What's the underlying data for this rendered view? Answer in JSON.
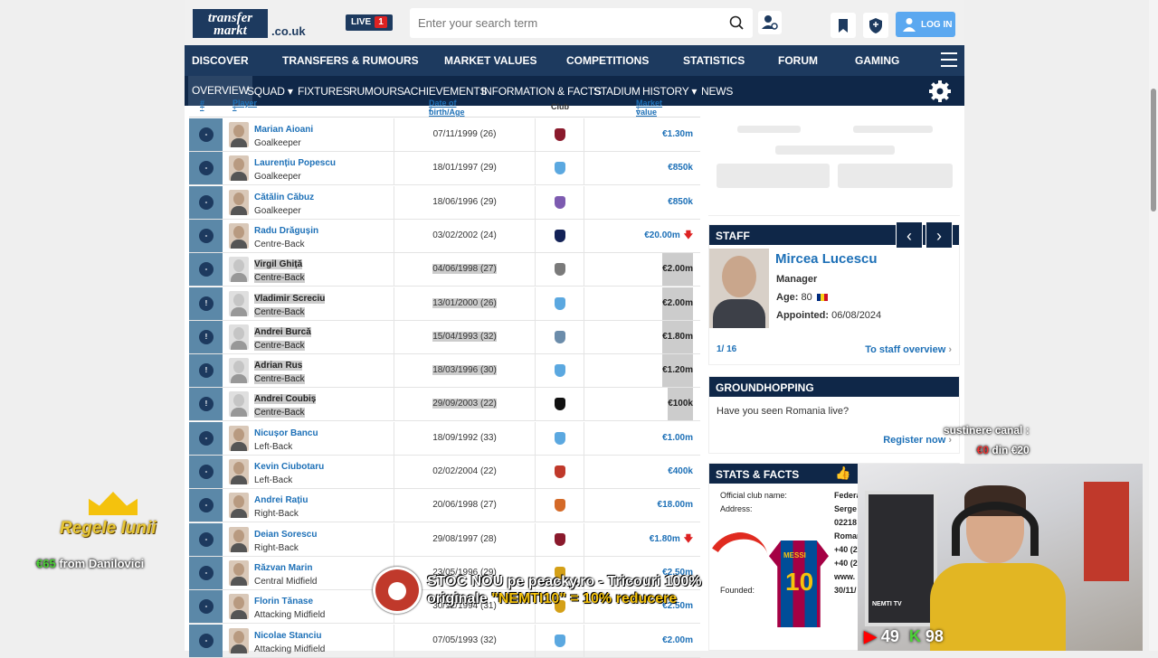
{
  "header": {
    "logo_text": "transfermarkt",
    "logo_suffix": ".co.uk",
    "live_label": "LIVE",
    "live_count": "1",
    "search_placeholder": "Enter your search term",
    "login_label": "LOG IN"
  },
  "main_nav": [
    "DISCOVER",
    "TRANSFERS & RUMOURS",
    "MARKET VALUES",
    "COMPETITIONS",
    "STATISTICS",
    "FORUM",
    "GAMING"
  ],
  "sub_nav": [
    "OVERVIEW",
    "SQUAD",
    "FIXTURES",
    "RUMOURS",
    "ACHIEVEMENTS",
    "INFORMATION & FACTS",
    "STADIUM",
    "HISTORY",
    "NEWS"
  ],
  "table": {
    "headers": {
      "num": "#",
      "player": "Player",
      "dob": "Date of birth/Age",
      "club": "Club",
      "value": "Market value"
    },
    "rows": [
      {
        "name": "Marian Aioani",
        "pos": "Goalkeeper",
        "dob": "07/11/1999 (26)",
        "value": "€1.30m",
        "arrow": "",
        "num": "-",
        "club_color": "#8a1a2c",
        "hl": false
      },
      {
        "name": "Laurențiu Popescu",
        "pos": "Goalkeeper",
        "dob": "18/01/1997 (29)",
        "value": "€850k",
        "arrow": "",
        "num": "-",
        "club_color": "#5ba8e0",
        "hl": false
      },
      {
        "name": "Cătălin Căbuz",
        "pos": "Goalkeeper",
        "dob": "18/06/1996 (29)",
        "value": "€850k",
        "arrow": "",
        "num": "-",
        "club_color": "#7d5bb0",
        "hl": false
      },
      {
        "name": "Radu Drăgușin",
        "pos": "Centre-Back",
        "dob": "03/02/2002 (24)",
        "value": "€20.00m",
        "arrow": "down",
        "num": "-",
        "club_color": "#132257",
        "hl": false
      },
      {
        "name": "Virgil Ghiță",
        "pos": "Centre-Back",
        "dob": "04/06/1998 (27)",
        "value": "€2.00m",
        "arrow": "",
        "num": "-",
        "club_color": "#7a7a7a",
        "hl": true
      },
      {
        "name": "Vladimir Screciu",
        "pos": "Centre-Back",
        "dob": "13/01/2000 (26)",
        "value": "€2.00m",
        "arrow": "",
        "num": "!",
        "club_color": "#5ba8e0",
        "hl": true
      },
      {
        "name": "Andrei Burcă",
        "pos": "Centre-Back",
        "dob": "15/04/1993 (32)",
        "value": "€1.80m",
        "arrow": "",
        "num": "!",
        "club_color": "#6b8caa",
        "hl": true
      },
      {
        "name": "Adrian Rus",
        "pos": "Centre-Back",
        "dob": "18/03/1996 (30)",
        "value": "€1.20m",
        "arrow": "",
        "num": "!",
        "club_color": "#5ba8e0",
        "hl": true
      },
      {
        "name": "Andrei Coubiș",
        "pos": "Centre-Back",
        "dob": "29/09/2003 (22)",
        "value": "€100k",
        "arrow": "",
        "num": "!",
        "club_color": "#111111",
        "hl": true
      },
      {
        "name": "Nicușor Bancu",
        "pos": "Left-Back",
        "dob": "18/09/1992 (33)",
        "value": "€1.00m",
        "arrow": "",
        "num": "-",
        "club_color": "#5ba8e0",
        "hl": false
      },
      {
        "name": "Kevin Ciubotaru",
        "pos": "Left-Back",
        "dob": "02/02/2004 (22)",
        "value": "€400k",
        "arrow": "",
        "num": "-",
        "club_color": "#c0392b",
        "hl": false
      },
      {
        "name": "Andrei Rațiu",
        "pos": "Right-Back",
        "dob": "20/06/1998 (27)",
        "value": "€18.00m",
        "arrow": "",
        "num": "-",
        "club_color": "#d46a28",
        "hl": false
      },
      {
        "name": "Deian Sorescu",
        "pos": "Right-Back",
        "dob": "29/08/1997 (28)",
        "value": "€1.80m",
        "arrow": "down",
        "num": "-",
        "club_color": "#8a1a2c",
        "hl": false
      },
      {
        "name": "Răzvan Marin",
        "pos": "Central Midfield",
        "dob": "23/05/1996 (29)",
        "value": "€2.50m",
        "arrow": "",
        "num": "-",
        "club_color": "#d4a017",
        "hl": false
      },
      {
        "name": "Florin Tănase",
        "pos": "Attacking Midfield",
        "dob": "30/12/1994 (31)",
        "value": "€2.50m",
        "arrow": "",
        "num": "-",
        "club_color": "#d4a017",
        "hl": false
      },
      {
        "name": "Nicolae Stanciu",
        "pos": "Attacking Midfield",
        "dob": "07/05/1993 (32)",
        "value": "€2.00m",
        "arrow": "",
        "num": "-",
        "club_color": "#5ba8e0",
        "hl": false
      }
    ]
  },
  "staff": {
    "title": "STAFF",
    "name": "Mircea Lucescu",
    "role": "Manager",
    "age_label": "Age:",
    "age": "80",
    "appointed_label": "Appointed:",
    "appointed": "06/08/2024",
    "pager": "1/ 16",
    "overview_link": "To staff overview"
  },
  "groundhopping": {
    "title": "GROUNDHOPPING",
    "question": "Have you seen Romania live?",
    "register": "Register now"
  },
  "stats_facts": {
    "title": "STATS & FACTS",
    "rows": [
      {
        "label": "Official club name:",
        "value": "Federa"
      },
      {
        "label": "Address:",
        "value": "Serge"
      },
      {
        "label": "",
        "value": "02218"
      },
      {
        "label": "",
        "value": "Roman"
      },
      {
        "label": "",
        "value": "+40 (2"
      },
      {
        "label": "",
        "value": "+40 (2"
      },
      {
        "label": "",
        "value": "www."
      },
      {
        "label": "Founded:",
        "value": "30/11/"
      }
    ]
  },
  "overlays": {
    "support_line1": "sustinere canal :",
    "support_amt1": "€0",
    "support_line2": "din €20",
    "regele": "Regele lunii",
    "donor_amt": "€65",
    "donor_text": "from Danilovici",
    "promo_line1": "STOC NOU pe peacky.ro - Tricouri 100%",
    "promo_line2a": "originale",
    "promo_code": "\"NEMTI10\" = 10% reducere",
    "jersey_name": "MESSI",
    "jersey_number": "10",
    "yt_count": "49",
    "kick_count": "98",
    "cam_label": "NEMTI TV"
  }
}
